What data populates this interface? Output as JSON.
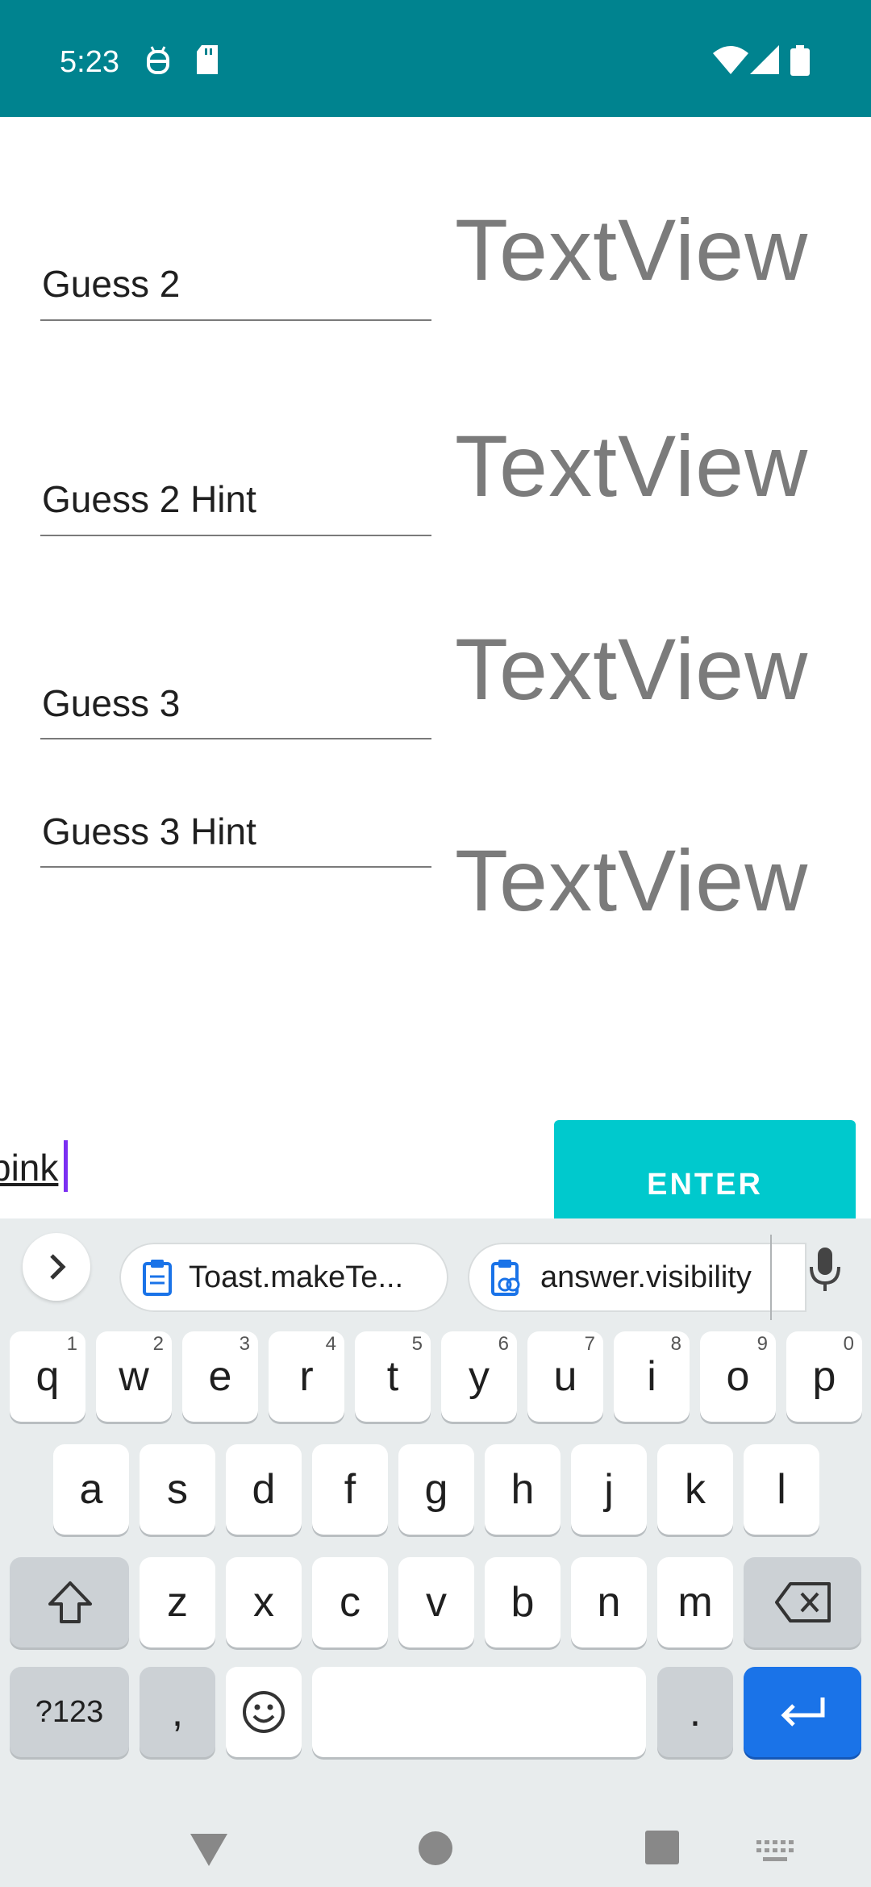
{
  "status_bar": {
    "time": "5:23",
    "icons": [
      "android-robot-icon",
      "sd-card-icon",
      "wifi-icon",
      "signal-icon",
      "battery-icon"
    ]
  },
  "form": {
    "rows": [
      {
        "field_text": "Guess 2",
        "text_view": "TextView"
      },
      {
        "field_text": "Guess 2 Hint",
        "text_view": "TextView"
      },
      {
        "field_text": "Guess 3",
        "text_view": "TextView"
      },
      {
        "field_text": "Guess 3 Hint",
        "text_view": "TextView"
      }
    ],
    "answer_value": "pink",
    "enter_label": "ENTER"
  },
  "keyboard": {
    "suggestions": [
      {
        "label": "Toast.makeTe...",
        "icon": "clipboard-icon"
      },
      {
        "label": "answer.visibility",
        "icon": "clipboard-link-icon"
      }
    ],
    "row1": [
      {
        "letter": "q",
        "num": "1"
      },
      {
        "letter": "w",
        "num": "2"
      },
      {
        "letter": "e",
        "num": "3"
      },
      {
        "letter": "r",
        "num": "4"
      },
      {
        "letter": "t",
        "num": "5"
      },
      {
        "letter": "y",
        "num": "6"
      },
      {
        "letter": "u",
        "num": "7"
      },
      {
        "letter": "i",
        "num": "8"
      },
      {
        "letter": "o",
        "num": "9"
      },
      {
        "letter": "p",
        "num": "0"
      }
    ],
    "row2": [
      "a",
      "s",
      "d",
      "f",
      "g",
      "h",
      "j",
      "k",
      "l"
    ],
    "row3": [
      "z",
      "x",
      "c",
      "v",
      "b",
      "n",
      "m"
    ],
    "symbols_label": "?123",
    "comma_label": ",",
    "period_label": ".",
    "accent_color": "#1a73e8"
  }
}
